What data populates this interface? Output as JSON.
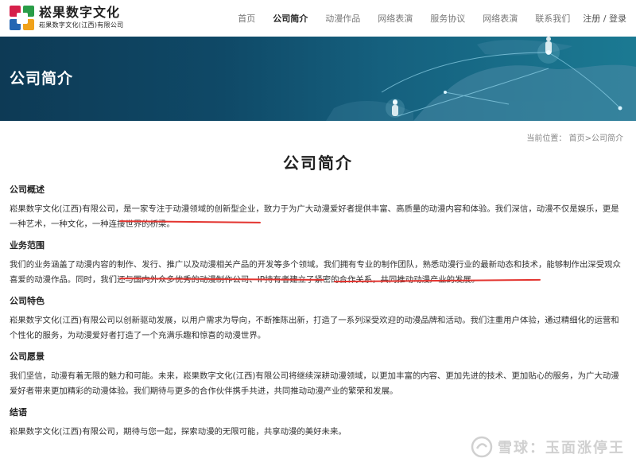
{
  "brand": {
    "name": "崧果数字文化",
    "subtitle": "崧果数字文化(江西)有限公司",
    "colors": [
      "#d6204a",
      "#2a9d48",
      "#2466b3",
      "#f0a21b"
    ]
  },
  "nav": {
    "items": [
      "首页",
      "公司简介",
      "动漫作品",
      "网络表演",
      "服务协议",
      "网络表演",
      "联系我们"
    ],
    "active_index": 1,
    "auth": "注册 / 登录"
  },
  "banner": {
    "title": "公司简介"
  },
  "breadcrumb": {
    "prefix": "当前位置：",
    "home": "首页",
    "separator": ">",
    "current": "公司简介"
  },
  "page_title": "公司简介",
  "sections": [
    {
      "title": "公司概述",
      "body": "崧果数字文化(江西)有限公司，是一家专注于动漫领域的创新型企业，致力于为广大动漫爱好者提供丰富、高质量的动漫内容和体验。我们深信，动漫不仅是娱乐，更是一种艺术，一种文化，一种连接世界的桥梁。"
    },
    {
      "title": "业务范围",
      "body": "我们的业务涵盖了动漫内容的制作、发行、推广以及动漫相关产品的开发等多个领域。我们拥有专业的制作团队，熟悉动漫行业的最新动态和技术，能够制作出深受观众喜爱的动漫作品。同时，我们还与国内外众多优秀的动漫制作公司、IP持有者建立了紧密的合作关系，共同推动动漫产业的发展。"
    },
    {
      "title": "公司特色",
      "body": "崧果数字文化(江西)有限公司以创新驱动发展，以用户需求为导向，不断推陈出新，打造了一系列深受欢迎的动漫品牌和活动。我们注重用户体验，通过精细化的运营和个性化的服务，为动漫爱好者打造了一个充满乐趣和惊喜的动漫世界。"
    },
    {
      "title": "公司愿景",
      "body": "我们坚信，动漫有着无限的魅力和可能。未来，崧果数字文化(江西)有限公司将继续深耕动漫领域，以更加丰富的内容、更加先进的技术、更加贴心的服务，为广大动漫爱好者带来更加精彩的动漫体验。我们期待与更多的合作伙伴携手共进，共同推动动漫产业的繁荣和发展。"
    },
    {
      "title": "结语",
      "body": "崧果数字文化(江西)有限公司，期待与您一起，探索动漫的无限可能，共享动漫的美好未来。"
    }
  ],
  "watermark": {
    "text": "雪球：玉面涨停王",
    "icon": "snowball-logo-icon"
  },
  "annotation_color": "#e3342f"
}
